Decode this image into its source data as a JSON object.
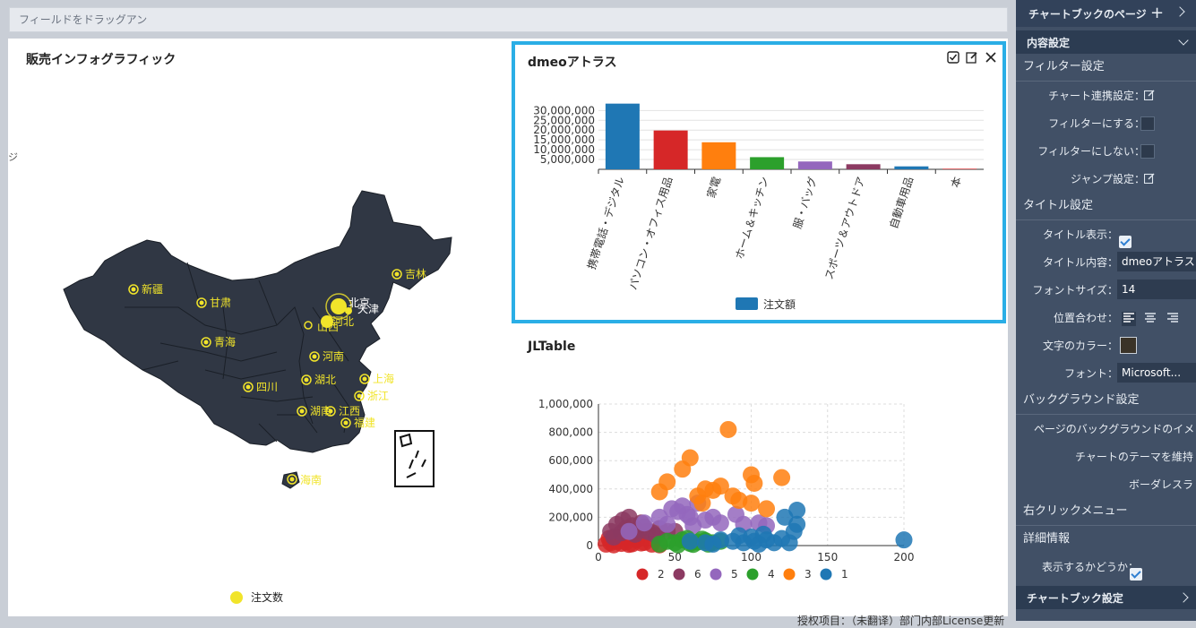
{
  "dropzone": {
    "placeholder": "フィールドをドラッグアン"
  },
  "edge_glyph": "ジ",
  "map_panel": {
    "title": "販売インフォグラフィック",
    "legend_label": "注文数",
    "legend_color": "#f1e42a",
    "provinces": [
      "新疆",
      "甘肃",
      "青海",
      "四川",
      "北京",
      "天津",
      "河北",
      "山西",
      "河南",
      "湖北",
      "湖南",
      "江西",
      "上海",
      "浙江",
      "福建",
      "吉林",
      "海南"
    ]
  },
  "bar_panel": {
    "title": "dmeoアトラス",
    "tool_icons": [
      "checkbox-icon",
      "edit-icon",
      "close-icon"
    ]
  },
  "scatter_panel": {
    "title": "JLTable"
  },
  "chart_data": [
    {
      "type": "bar",
      "title": "dmeoアトラス",
      "categories": [
        "携帯電話・デジタル",
        "パソコン・オフィス用品",
        "家電",
        "ホーム＆キッチン",
        "服・バッグ",
        "スポーツ＆アウトドア",
        "自動車用品",
        "本"
      ],
      "series": [
        {
          "name": "注文額",
          "values": [
            33500000,
            19800000,
            13800000,
            6200000,
            4000000,
            2600000,
            1500000,
            300000
          ],
          "color": "#1f77b4"
        }
      ],
      "colors": [
        "#1f77b4",
        "#d62728",
        "#ff7f0e",
        "#2ca02c",
        "#9467bd",
        "#8c3a62",
        "#1f77b4",
        "#d62728"
      ],
      "ytick_labels": [
        "5,000,000",
        "10,000,000",
        "15,000,000",
        "20,000,000",
        "25,000,000",
        "30,000,000"
      ],
      "ylim": [
        0,
        37000000
      ],
      "legend": "bottom"
    },
    {
      "type": "scatter",
      "title": "JLTable",
      "xlim": [
        0,
        200
      ],
      "ylim": [
        0,
        1000000
      ],
      "xticks": [
        "0",
        "50",
        "100",
        "150",
        "200"
      ],
      "yticks": [
        "0",
        "200,000",
        "400,000",
        "600,000",
        "800,000",
        "1,000,000"
      ],
      "grid": true,
      "legend": "bottom",
      "series": [
        {
          "name": "2",
          "color": "#d62728",
          "points": [
            [
              5,
              10000
            ],
            [
              8,
              20000
            ],
            [
              10,
              5000
            ],
            [
              12,
              30000
            ],
            [
              15,
              15000
            ],
            [
              18,
              25000
            ],
            [
              20,
              8000
            ],
            [
              22,
              12000
            ],
            [
              25,
              40000
            ],
            [
              28,
              18000
            ],
            [
              30,
              22000
            ],
            [
              7,
              50000
            ],
            [
              14,
              60000
            ],
            [
              35,
              10000
            ],
            [
              40,
              5000
            ]
          ]
        },
        {
          "name": "6",
          "color": "#8c3a62",
          "points": [
            [
              8,
              100000
            ],
            [
              12,
              150000
            ],
            [
              15,
              90000
            ],
            [
              18,
              120000
            ],
            [
              20,
              200000
            ],
            [
              22,
              140000
            ],
            [
              25,
              110000
            ],
            [
              28,
              160000
            ],
            [
              30,
              130000
            ],
            [
              32,
              100000
            ],
            [
              35,
              90000
            ],
            [
              40,
              120000
            ],
            [
              45,
              100000
            ],
            [
              10,
              60000
            ],
            [
              16,
              180000
            ],
            [
              24,
              80000
            ],
            [
              38,
              70000
            ],
            [
              50,
              100000
            ]
          ]
        },
        {
          "name": "5",
          "color": "#9467bd",
          "points": [
            [
              20,
              100000
            ],
            [
              30,
              160000
            ],
            [
              40,
              200000
            ],
            [
              45,
              150000
            ],
            [
              48,
              260000
            ],
            [
              52,
              240000
            ],
            [
              55,
              280000
            ],
            [
              58,
              220000
            ],
            [
              60,
              200000
            ],
            [
              62,
              140000
            ],
            [
              65,
              300000
            ],
            [
              70,
              180000
            ],
            [
              75,
              200000
            ],
            [
              80,
              160000
            ],
            [
              90,
              220000
            ],
            [
              95,
              150000
            ],
            [
              105,
              160000
            ],
            [
              110,
              140000
            ]
          ]
        },
        {
          "name": "4",
          "color": "#2ca02c",
          "points": [
            [
              40,
              10000
            ],
            [
              45,
              30000
            ],
            [
              50,
              20000
            ],
            [
              55,
              40000
            ],
            [
              60,
              15000
            ],
            [
              65,
              25000
            ],
            [
              70,
              35000
            ],
            [
              72,
              10000
            ],
            [
              75,
              20000
            ],
            [
              80,
              30000
            ],
            [
              52,
              5000
            ],
            [
              62,
              8000
            ],
            [
              68,
              45000
            ],
            [
              58,
              50000
            ]
          ]
        },
        {
          "name": "3",
          "color": "#ff7f0e",
          "points": [
            [
              40,
              380000
            ],
            [
              45,
              450000
            ],
            [
              55,
              540000
            ],
            [
              60,
              620000
            ],
            [
              65,
              350000
            ],
            [
              70,
              400000
            ],
            [
              75,
              390000
            ],
            [
              80,
              420000
            ],
            [
              85,
              820000
            ],
            [
              88,
              350000
            ],
            [
              100,
              500000
            ],
            [
              100,
              300000
            ],
            [
              102,
              440000
            ],
            [
              110,
              260000
            ],
            [
              120,
              480000
            ],
            [
              68,
              300000
            ],
            [
              92,
              320000
            ]
          ]
        },
        {
          "name": "1",
          "color": "#1f77b4",
          "points": [
            [
              60,
              30000
            ],
            [
              70,
              20000
            ],
            [
              75,
              10000
            ],
            [
              80,
              40000
            ],
            [
              88,
              30000
            ],
            [
              95,
              20000
            ],
            [
              100,
              60000
            ],
            [
              102,
              30000
            ],
            [
              105,
              10000
            ],
            [
              110,
              40000
            ],
            [
              115,
              20000
            ],
            [
              120,
              50000
            ],
            [
              122,
              200000
            ],
            [
              125,
              20000
            ],
            [
              128,
              100000
            ],
            [
              130,
              250000
            ],
            [
              130,
              150000
            ],
            [
              200,
              40000
            ],
            [
              108,
              80000
            ],
            [
              92,
              70000
            ]
          ]
        }
      ]
    }
  ],
  "sidebar": {
    "chartbook_page": "チャートブックのページ",
    "content_settings": "内容設定",
    "filter_settings": "フィルター設定",
    "chart_link": "チャート連携設定：",
    "filter_on": "フィルターにする：",
    "filter_off": "フィルターにしない：",
    "jump": "ジャンプ設定：",
    "title_settings": "タイトル設定",
    "title_show": "タイトル表示：",
    "title_content": "タイトル内容：",
    "title_content_value": "dmeoアトラス",
    "font_size": "フォントサイズ：",
    "font_size_value": "14",
    "align": "位置合わせ：",
    "text_color": "文字のカラー：",
    "text_color_value": "#3a3328",
    "font": "フォント：",
    "font_value": "Microsoft...",
    "background_settings": "バックグラウンド設定",
    "page_bg": "ページのバックグラウンドのイメ",
    "keep_theme": "チャートのテーマを維持",
    "borderless": "ボーダレスラ",
    "right_click": "右クリックメニュー",
    "details": "詳細情報",
    "show": "表示するかどうか：",
    "chartbook_settings": "チャートブック設定"
  },
  "footer_text": "授权项目：（未翻译）部门内部License更新"
}
